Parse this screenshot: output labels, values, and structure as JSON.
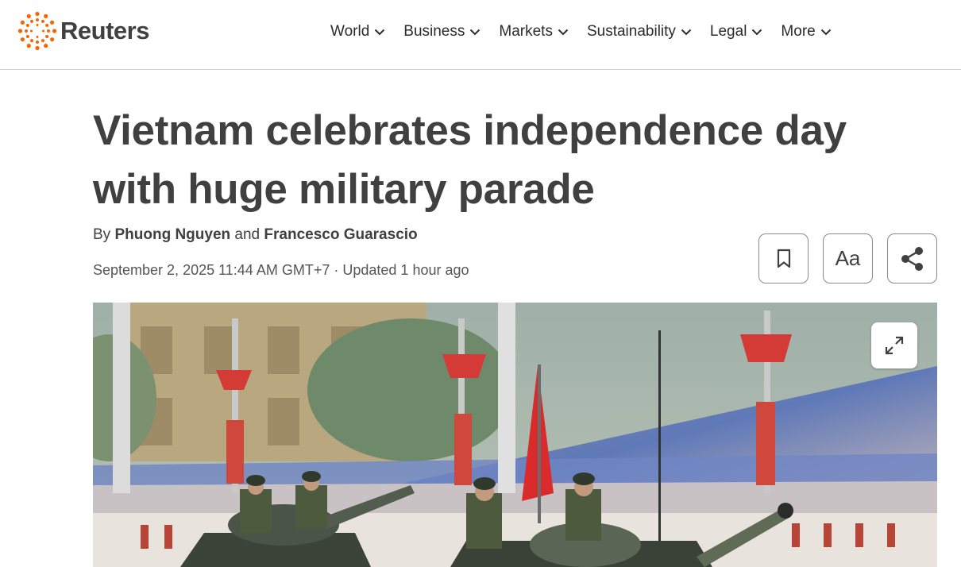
{
  "brand": {
    "name": "Reuters",
    "accent_color": "#fa6400"
  },
  "nav": {
    "items": [
      {
        "label": "World"
      },
      {
        "label": "Business"
      },
      {
        "label": "Markets"
      },
      {
        "label": "Sustainability"
      },
      {
        "label": "Legal"
      },
      {
        "label": "More"
      }
    ]
  },
  "article": {
    "headline_line1": "Vietnam celebrates independence day",
    "headline_line2": "with huge military parade",
    "byline_prefix": "By",
    "author1": "Phuong Nguyen",
    "byline_conj": "and",
    "author2": "Francesco Guarascio",
    "date": "September 2, 2025 11:44 AM GMT+7",
    "separator": "·",
    "updated": "Updated 1 hour ago"
  },
  "tools": {
    "bookmark_icon": "bookmark-icon",
    "text_size_label": "Aa",
    "share_icon": "share-icon",
    "expand_icon": "expand-icon"
  }
}
